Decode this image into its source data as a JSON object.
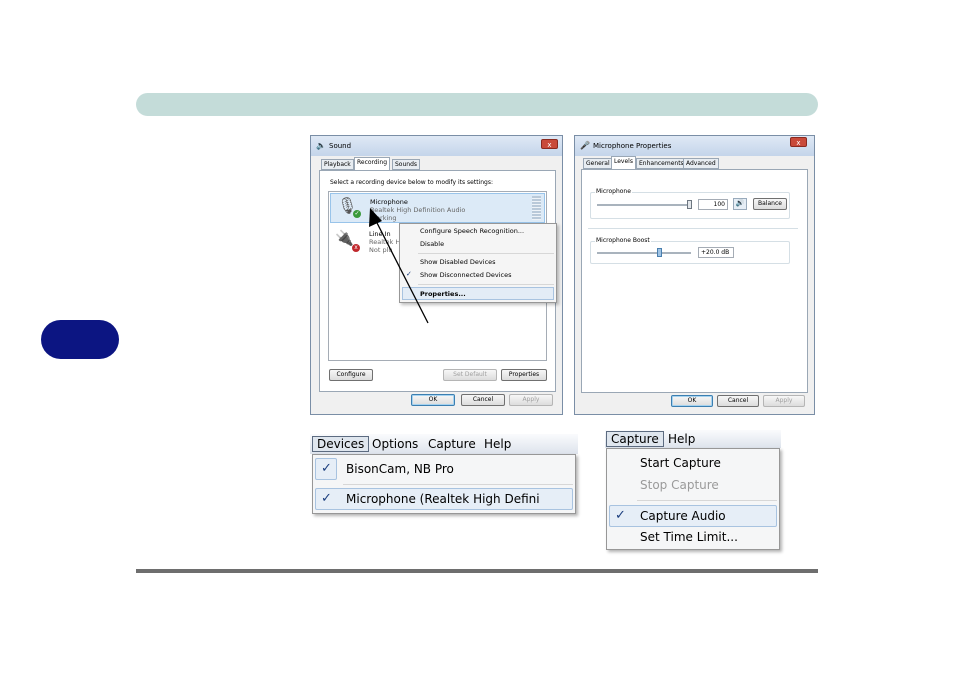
{
  "sound_dialog": {
    "title": "Sound",
    "tabs": [
      "Playback",
      "Recording",
      "Sounds"
    ],
    "instruction": "Select a recording device below to modify its settings:",
    "devices": [
      {
        "name": "Microphone",
        "driver": "Realtek High Definition Audio",
        "status": "Working"
      },
      {
        "name": "Line In",
        "driver": "Realtek H",
        "status": "Not plu"
      }
    ],
    "context_menu": [
      "Configure Speech Recognition...",
      "Disable",
      "Show Disabled Devices",
      "Show Disconnected Devices",
      "Properties..."
    ],
    "buttons": {
      "configure": "Configure",
      "set_default": "Set Default",
      "properties": "Properties",
      "ok": "OK",
      "cancel": "Cancel",
      "apply": "Apply"
    }
  },
  "mic_props": {
    "title": "Microphone Properties",
    "tabs": [
      "General",
      "Levels",
      "Enhancements",
      "Advanced"
    ],
    "level_label": "Microphone",
    "level_value": "100",
    "level_fraction": 1.0,
    "balance_label": "Balance",
    "boost_label": "Microphone Boost",
    "boost_value": "+20.0 dB",
    "boost_fraction": 0.67,
    "buttons": {
      "ok": "OK",
      "cancel": "Cancel",
      "apply": "Apply"
    }
  },
  "devices_menu": {
    "menubar": [
      "Devices",
      "Options",
      "Capture",
      "Help"
    ],
    "items": [
      "BisonCam, NB Pro",
      "Microphone (Realtek High Defini"
    ]
  },
  "capture_menu": {
    "menubar": [
      "Capture",
      "Help"
    ],
    "items": [
      "Start Capture",
      "Stop Capture",
      "Capture Audio",
      "Set Time Limit..."
    ]
  },
  "glyphs": {
    "check": "✓",
    "close": "x"
  }
}
